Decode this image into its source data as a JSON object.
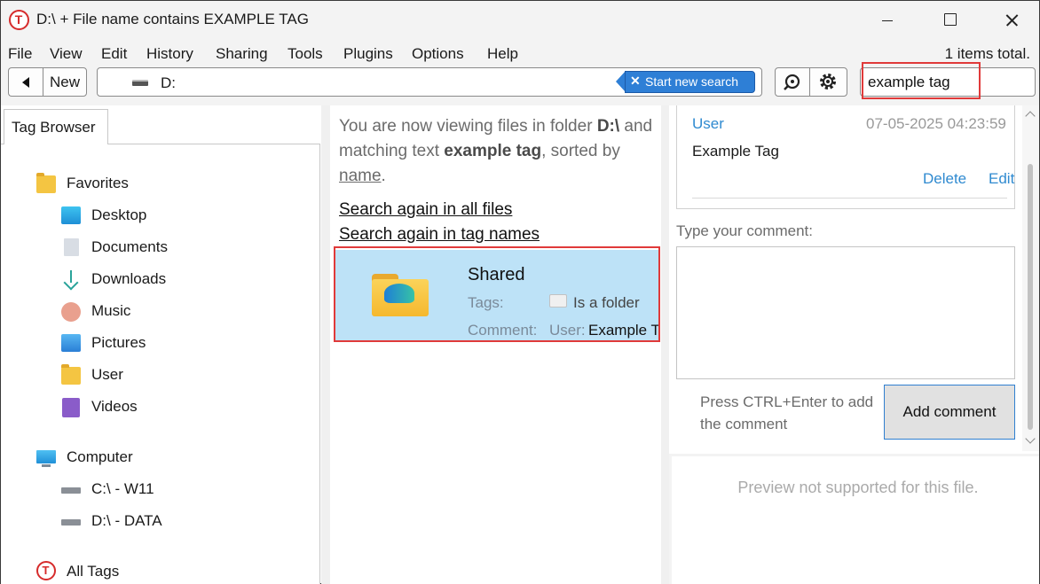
{
  "window": {
    "title": "D:\\  +  File name contains EXAMPLE TAG"
  },
  "menu": [
    "File",
    "View",
    "Edit",
    "History",
    "Sharing",
    "Tools",
    "Plugins",
    "Options",
    "Help"
  ],
  "status": {
    "items_total": "1 items total."
  },
  "toolbar": {
    "new_label": "New",
    "path": "D:",
    "new_search_label": "Start new search",
    "search_value": "example tag"
  },
  "left": {
    "tab_label": "Tag Browser",
    "favorites_label": "Favorites",
    "favorites": [
      "Desktop",
      "Documents",
      "Downloads",
      "Music",
      "Pictures",
      "User",
      "Videos"
    ],
    "computer_label": "Computer",
    "drives": [
      "C:\\ - W11",
      "D:\\ - DATA"
    ],
    "all_tags_label": "All Tags"
  },
  "middle": {
    "intro_1": "You are now viewing files in folder ",
    "folder": "D:\\",
    "intro_2": " and  matching text ",
    "query": "example tag",
    "intro_3": ", sorted by ",
    "sort": "name",
    "intro_4": ".",
    "link_all_files": "Search again in all files",
    "link_tag_names": "Search again in tag names",
    "result": {
      "name": "Shared",
      "tags_label": "Tags:",
      "tag_value": "Is a folder",
      "comment_label": "Comment:",
      "comment_user": "User:",
      "comment_text": "Example Tag"
    }
  },
  "right": {
    "comment": {
      "user": "User",
      "date": "07-05-2025 04:23:59",
      "text": "Example Tag",
      "delete_label": "Delete",
      "edit_label": "Edit"
    },
    "type_label": "Type your comment:",
    "hint": "Press CTRL+Enter to add the comment",
    "add_label": "Add comment",
    "preview_text": "Preview not supported for this file."
  },
  "colors": {
    "accent": "#2e7fd6",
    "selection": "#bde2f7",
    "highlight": "#e03a3a",
    "brand_red": "#d62b2b"
  },
  "icons": [
    "app-logo-icon",
    "back-icon",
    "drive-icon",
    "close-icon",
    "search-tool-icon",
    "settings-icon",
    "folder-icon",
    "desktop-icon",
    "documents-icon",
    "downloads-icon",
    "music-icon",
    "pictures-icon",
    "videos-icon",
    "computer-icon",
    "all-tags-icon"
  ]
}
